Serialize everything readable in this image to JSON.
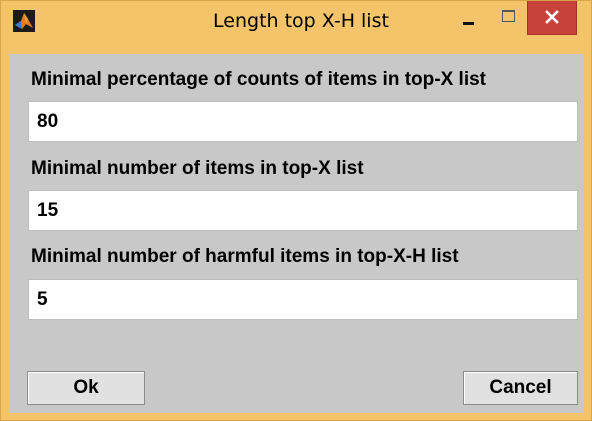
{
  "window": {
    "title": "Length top X-H list",
    "app_icon": "matlab-icon",
    "controls": {
      "minimize_icon": "minimize-icon",
      "maximize_icon": "maximize-icon",
      "close_icon": "close-icon"
    },
    "colors": {
      "frame": "#f4c46a",
      "client": "#c8c8c8",
      "close_button": "#c8423b"
    }
  },
  "form": {
    "fields": [
      {
        "label": "Minimal percentage of counts of items in top-X list",
        "value": "80"
      },
      {
        "label": "Minimal number of items in top-X list",
        "value": "15"
      },
      {
        "label": "Minimal number of harmful items in top-X-H list",
        "value": "5"
      }
    ]
  },
  "buttons": {
    "ok_label": "Ok",
    "cancel_label": "Cancel"
  }
}
